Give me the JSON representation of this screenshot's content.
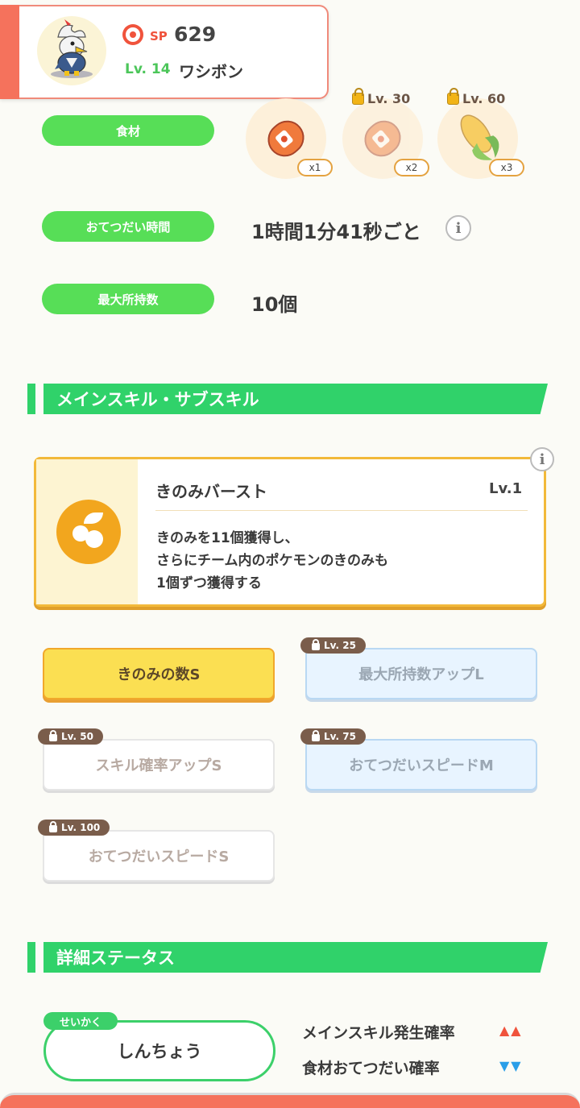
{
  "header": {
    "sp_label": "SP",
    "sp_value": "629",
    "level": "Lv. 14",
    "name": "ワシボン"
  },
  "ingredients": {
    "label": "食材",
    "items": [
      {
        "count": "x1",
        "lock": ""
      },
      {
        "count": "x2",
        "lock": "Lv. 30"
      },
      {
        "count": "x3",
        "lock": "Lv. 60"
      }
    ]
  },
  "help_time": {
    "label": "おてつだい時間",
    "value": "1時間1分41秒ごと"
  },
  "max_carry": {
    "label": "最大所持数",
    "value": "10個"
  },
  "skill_section": {
    "title": "メインスキル・サブスキル"
  },
  "main_skill": {
    "name": "きのみバースト",
    "level": "Lv.1",
    "desc": [
      "きのみを11個獲得し、",
      "さらにチーム内のポケモンのきのみも",
      "1個ずつ獲得する"
    ]
  },
  "sub_skills": [
    {
      "label": "きのみの数S",
      "lock": ""
    },
    {
      "label": "最大所持数アップL",
      "lock": "Lv. 25"
    },
    {
      "label": "スキル確率アップS",
      "lock": "Lv. 50"
    },
    {
      "label": "おてつだいスピードM",
      "lock": "Lv. 75"
    },
    {
      "label": "おてつだいスピードS",
      "lock": "Lv. 100"
    }
  ],
  "detail_section": {
    "title": "詳細ステータス"
  },
  "nature": {
    "tag": "せいかく",
    "value": "しんちょう",
    "stats": [
      {
        "label": "メインスキル発生確率",
        "arrows": "▲▲",
        "color": "#f0533c"
      },
      {
        "label": "食材おてつだい確率",
        "arrows": "▼▼",
        "color": "#2a9ee8"
      }
    ]
  },
  "icons": {
    "info": "i"
  }
}
